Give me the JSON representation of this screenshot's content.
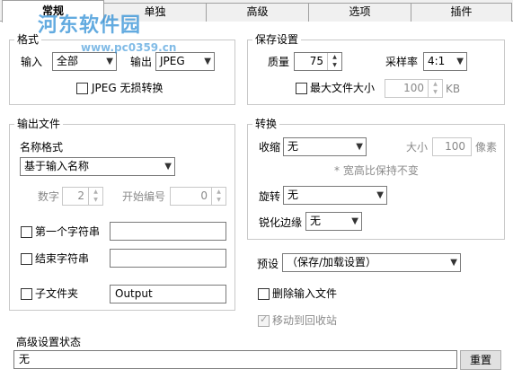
{
  "tabs": [
    {
      "label": "常规"
    },
    {
      "label": "单独"
    },
    {
      "label": "高级"
    },
    {
      "label": "选项"
    },
    {
      "label": "插件"
    }
  ],
  "watermark": {
    "text": "河东软件园",
    "url": "www.pc0359.cn"
  },
  "format_group": {
    "title": "格式",
    "input_label": "输入",
    "input_value": "全部",
    "output_label": "输出",
    "output_value": "JPEG",
    "lossless_label": "JPEG 无损转换"
  },
  "save_group": {
    "title": "保存设置",
    "quality_label": "质量",
    "quality_value": "75",
    "sampling_label": "采样率",
    "sampling_value": "4:1",
    "maxsize_label": "最大文件大小",
    "maxsize_value": "100",
    "maxsize_unit": "KB"
  },
  "output_group": {
    "title": "输出文件",
    "name_format_label": "名称格式",
    "name_format_value": "基于输入名称",
    "digits_label": "数字",
    "digits_value": "2",
    "start_label": "开始编号",
    "start_value": "0",
    "first_string_label": "第一个字符串",
    "first_string_value": "",
    "end_string_label": "结束字符串",
    "end_string_value": "",
    "subfolder_label": "子文件夹",
    "subfolder_value": "Output"
  },
  "convert_group": {
    "title": "转换",
    "shrink_label": "收缩",
    "shrink_value": "无",
    "size_label": "大小",
    "size_value": "100",
    "size_unit": "像素",
    "note": "* 宽高比保持不变",
    "rotate_label": "旋转",
    "rotate_value": "无",
    "sharpen_label": "锐化边缘",
    "sharpen_value": "无"
  },
  "preset": {
    "label": "预设",
    "value": "（保存/加载设置）"
  },
  "delete_input_label": "删除输入文件",
  "move_recycle_label": "移动到回收站",
  "advanced_status": {
    "label": "高级设置状态",
    "value": "无",
    "reset_label": "重置"
  }
}
